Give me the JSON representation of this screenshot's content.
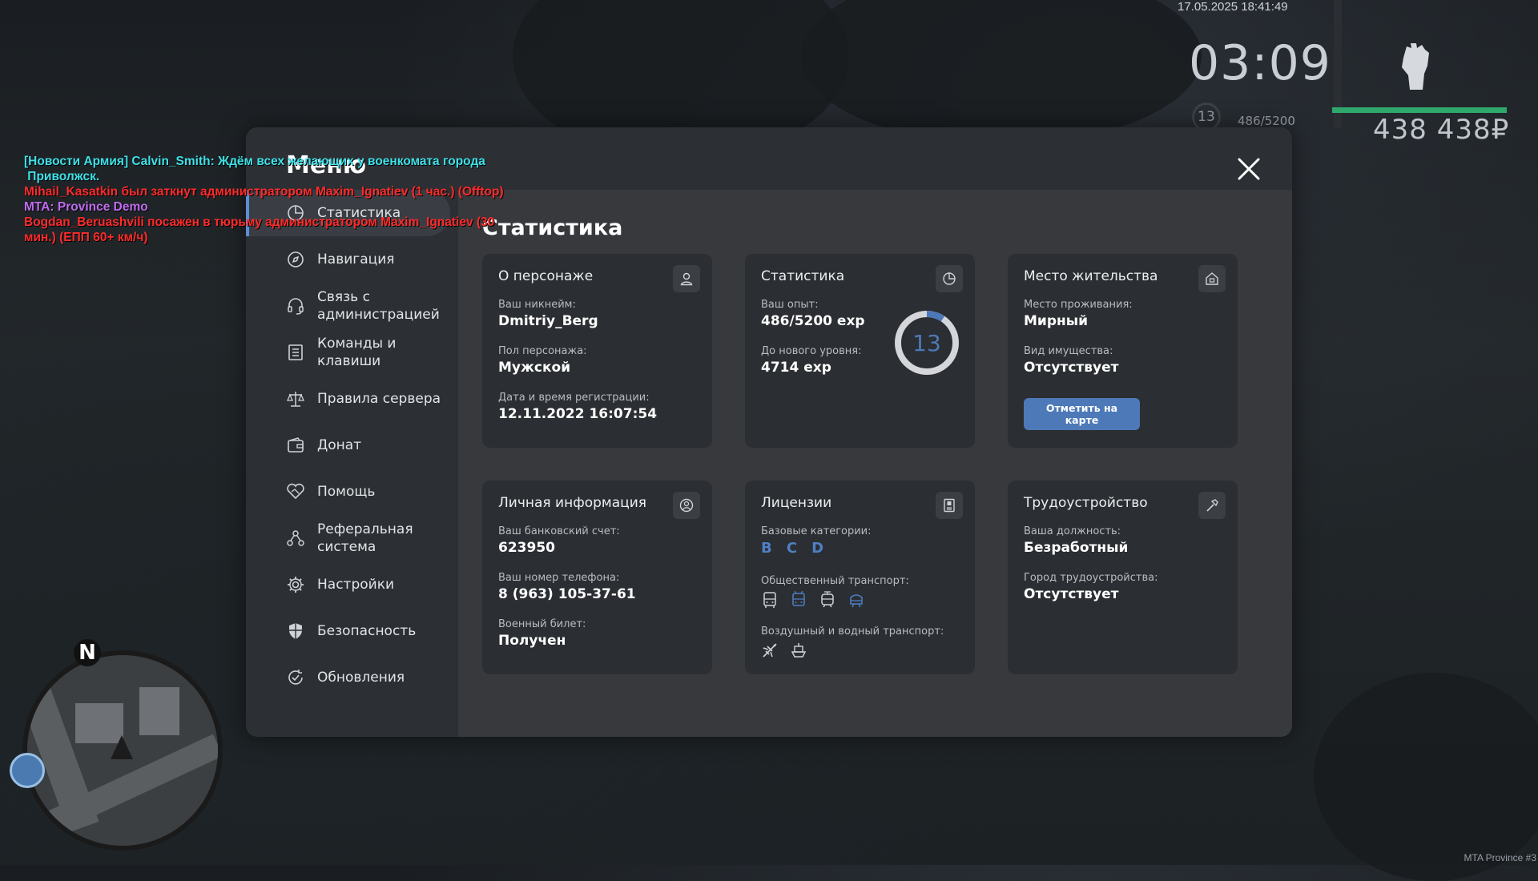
{
  "hud": {
    "datetime": "17.05.2025 18:41:49",
    "time": "03:09",
    "level": "13",
    "exp": "486/5200",
    "money": "438 438₽",
    "watermark": "MTA Province #3"
  },
  "chat": [
    {
      "text": "[Новости Армия] Calvin_Smith: Ждём всех желающих у военкомата города",
      "color": "#3fe0e8"
    },
    {
      "text": " Приволжск.",
      "color": "#3fe0e8"
    },
    {
      "text": "Mihail_Kasatkin был заткнут администратором Maxim_Ignatiev (1 час.) (Offtop)",
      "color": "#ff2b2b"
    },
    {
      "text": "MTA: Province Demo",
      "color": "#c06cf0"
    },
    {
      "text": "Bogdan_Beruashvili посажен в тюрьму администратором Maxim_Ignatiev (30",
      "color": "#ff2b2b"
    },
    {
      "text": "мин.) (ЕПП 60+ км/ч)",
      "color": "#ff2b2b"
    }
  ],
  "minimap": {
    "north": "N"
  },
  "menu": {
    "title": "Меню",
    "sidebar": [
      {
        "label": "Статистика",
        "icon": "pie-chart-icon",
        "active": true
      },
      {
        "label": "Навигация",
        "icon": "compass-icon"
      },
      {
        "label": "Связь с\nадминистрацией",
        "icon": "headset-icon"
      },
      {
        "label": "Команды и\nклавиши",
        "icon": "document-list-icon"
      },
      {
        "label": "Правила сервера",
        "icon": "scales-icon"
      },
      {
        "label": "Донат",
        "icon": "wallet-icon"
      },
      {
        "label": "Помощь",
        "icon": "handshake-icon"
      },
      {
        "label": "Реферальная\nсистема",
        "icon": "network-icon"
      },
      {
        "label": "Настройки",
        "icon": "gear-icon"
      },
      {
        "label": "Безопасность",
        "icon": "shield-icon"
      },
      {
        "label": "Обновления",
        "icon": "refresh-check-icon"
      }
    ],
    "content_title": "Статистика",
    "cards": {
      "character": {
        "title": "О персонаже",
        "icon": "user-icon",
        "nickname_label": "Ваш никнейм:",
        "nickname": "Dmitriy_Berg",
        "gender_label": "Пол персонажа:",
        "gender": "Мужской",
        "reg_label": "Дата и время регистрации:",
        "reg": "12.11.2022 16:07:54"
      },
      "stats": {
        "title": "Статистика",
        "icon": "pie-chart-icon",
        "exp_label": "Ваш опыт:",
        "exp": "486/5200 exp",
        "next_label": "До нового уровня:",
        "next": "4714 exp",
        "level": "13",
        "progress": 0.0935
      },
      "residence": {
        "title": "Место жительства",
        "icon": "house-icon",
        "place_label": "Место проживания:",
        "place": "Мирный",
        "property_label": "Вид имущества:",
        "property": "Отсутствует",
        "button": "Отметить на карте"
      },
      "personal": {
        "title": "Личная информация",
        "icon": "user-circle-icon",
        "bank_label": "Ваш банковский счет:",
        "bank": "623950",
        "phone_label": "Ваш номер телефона:",
        "phone": "8 (963) 105-37-61",
        "military_label": "Военный билет:",
        "military": "Получен"
      },
      "licenses": {
        "title": "Лицензии",
        "icon": "id-card-icon",
        "base_label": "Базовые категории:",
        "base": [
          "B",
          "C",
          "D"
        ],
        "public_label": "Общественный транспорт:",
        "air_label": "Воздушный и водный транспорт:"
      },
      "employment": {
        "title": "Трудоустройство",
        "icon": "hammer-icon",
        "position_label": "Ваша должность:",
        "position": "Безработный",
        "city_label": "Город трудоустройства:",
        "city": "Отсутствует"
      }
    }
  }
}
